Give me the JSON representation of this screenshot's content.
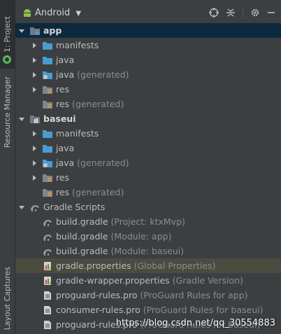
{
  "side_tabs": {
    "project": "1: Project",
    "resource_manager": "Resource Manager",
    "layout_captures": "Layout Captures"
  },
  "toolbar": {
    "title": "Android"
  },
  "tree": [
    {
      "label": "app",
      "secondary": "",
      "depth": 0,
      "icon": "module-icon",
      "arrow": "down",
      "bold": true,
      "highlight": true
    },
    {
      "label": "manifests",
      "secondary": "",
      "depth": 1,
      "icon": "folder-icon",
      "arrow": "right"
    },
    {
      "label": "java",
      "secondary": "",
      "depth": 1,
      "icon": "folder-icon",
      "arrow": "right"
    },
    {
      "label": "java",
      "secondary": " (generated)",
      "depth": 1,
      "icon": "generated-folder-icon",
      "arrow": "right"
    },
    {
      "label": "res",
      "secondary": "",
      "depth": 1,
      "icon": "res-folder-icon",
      "arrow": "right"
    },
    {
      "label": "res",
      "secondary": " (generated)",
      "depth": 1,
      "icon": "res-folder-icon",
      "arrow": "none"
    },
    {
      "label": "baseui",
      "secondary": "",
      "depth": 0,
      "icon": "library-module-icon",
      "arrow": "down",
      "bold": true
    },
    {
      "label": "manifests",
      "secondary": "",
      "depth": 1,
      "icon": "folder-icon",
      "arrow": "right"
    },
    {
      "label": "java",
      "secondary": "",
      "depth": 1,
      "icon": "folder-icon",
      "arrow": "right"
    },
    {
      "label": "java",
      "secondary": " (generated)",
      "depth": 1,
      "icon": "generated-folder-icon",
      "arrow": "right"
    },
    {
      "label": "res",
      "secondary": "",
      "depth": 1,
      "icon": "res-folder-icon",
      "arrow": "right"
    },
    {
      "label": "res",
      "secondary": " (generated)",
      "depth": 1,
      "icon": "res-folder-icon",
      "arrow": "none"
    },
    {
      "label": "Gradle Scripts",
      "secondary": "",
      "depth": 0,
      "icon": "gradle-icon",
      "arrow": "down"
    },
    {
      "label": "build.gradle",
      "secondary": " (Project: ktxMvp)",
      "depth": 1,
      "icon": "gradle-icon",
      "arrow": "none"
    },
    {
      "label": "build.gradle",
      "secondary": " (Module: app)",
      "depth": 1,
      "icon": "gradle-icon",
      "arrow": "none"
    },
    {
      "label": "build.gradle",
      "secondary": " (Module: baseui)",
      "depth": 1,
      "icon": "gradle-icon",
      "arrow": "none"
    },
    {
      "label": "gradle.properties",
      "secondary": " (Global Properties)",
      "depth": 1,
      "icon": "properties-icon",
      "arrow": "none",
      "selected": true
    },
    {
      "label": "gradle-wrapper.properties",
      "secondary": " (Gradle Version)",
      "depth": 1,
      "icon": "properties-icon",
      "arrow": "none"
    },
    {
      "label": "proguard-rules.pro",
      "secondary": " (ProGuard Rules for app)",
      "depth": 1,
      "icon": "text-file-icon",
      "arrow": "none"
    },
    {
      "label": "consumer-rules.pro",
      "secondary": " (ProGuard Rules for baseui)",
      "depth": 1,
      "icon": "text-file-icon",
      "arrow": "none"
    },
    {
      "label": "proguard-rules.pro",
      "secondary": " (ProGuard Rules for baseui)",
      "depth": 1,
      "icon": "text-file-icon",
      "arrow": "none"
    }
  ],
  "watermark": "https://blog.csdn.net/qq_30554883",
  "colors": {
    "background": "#3c3f41",
    "folder": "#4a9bd0",
    "selection": "#4b4b3f"
  }
}
